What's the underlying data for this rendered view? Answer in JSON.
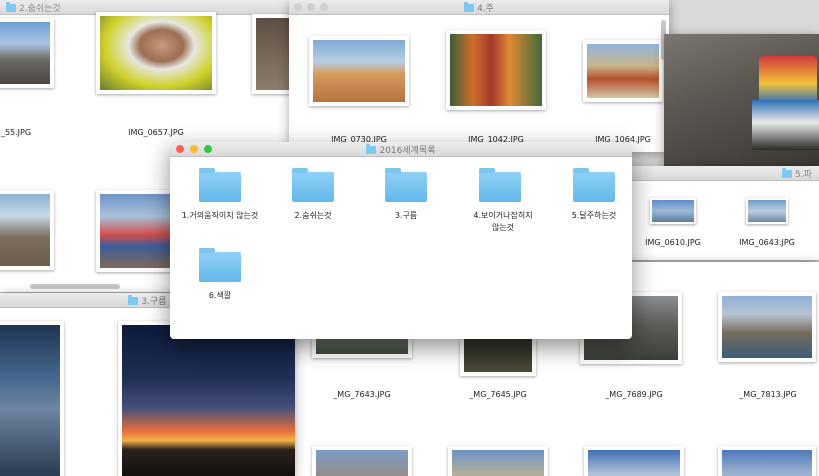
{
  "windows": {
    "top_left": {
      "title": "2.숨쉬는것",
      "captions": [
        "_55.JPG",
        "IMG_0657.JPG"
      ]
    },
    "top_center": {
      "title": "4.주",
      "captions": [
        "IMG_0730.JPG",
        "IMG_1042.JPG",
        "IMG_1064.JPG"
      ]
    },
    "right_mid": {
      "title": "5.파",
      "captions": [
        "IMG_0610.JPG",
        "IMG_0643.JPG"
      ]
    },
    "bottom_left": {
      "title": "3.구름"
    },
    "bottom_right": {
      "captions": [
        "_MG_7643.JPG",
        "_MG_7645.JPG",
        "_MG_7689.JPG",
        "_MG_7813.JPG"
      ]
    },
    "front": {
      "title": "2016세계목록",
      "folders": [
        {
          "label": "1.거의움직이지 않는것"
        },
        {
          "label": "2.숨쉬는것"
        },
        {
          "label": "3.구름"
        },
        {
          "label": "4.보이거나잡히지않는것"
        },
        {
          "label": "5.달주하는것"
        },
        {
          "label": "6.색깔"
        }
      ]
    }
  },
  "colors": {
    "folder": "#6cbdec",
    "close": "#fc5f57",
    "minimize": "#fdbc2e",
    "zoom": "#33c748"
  }
}
